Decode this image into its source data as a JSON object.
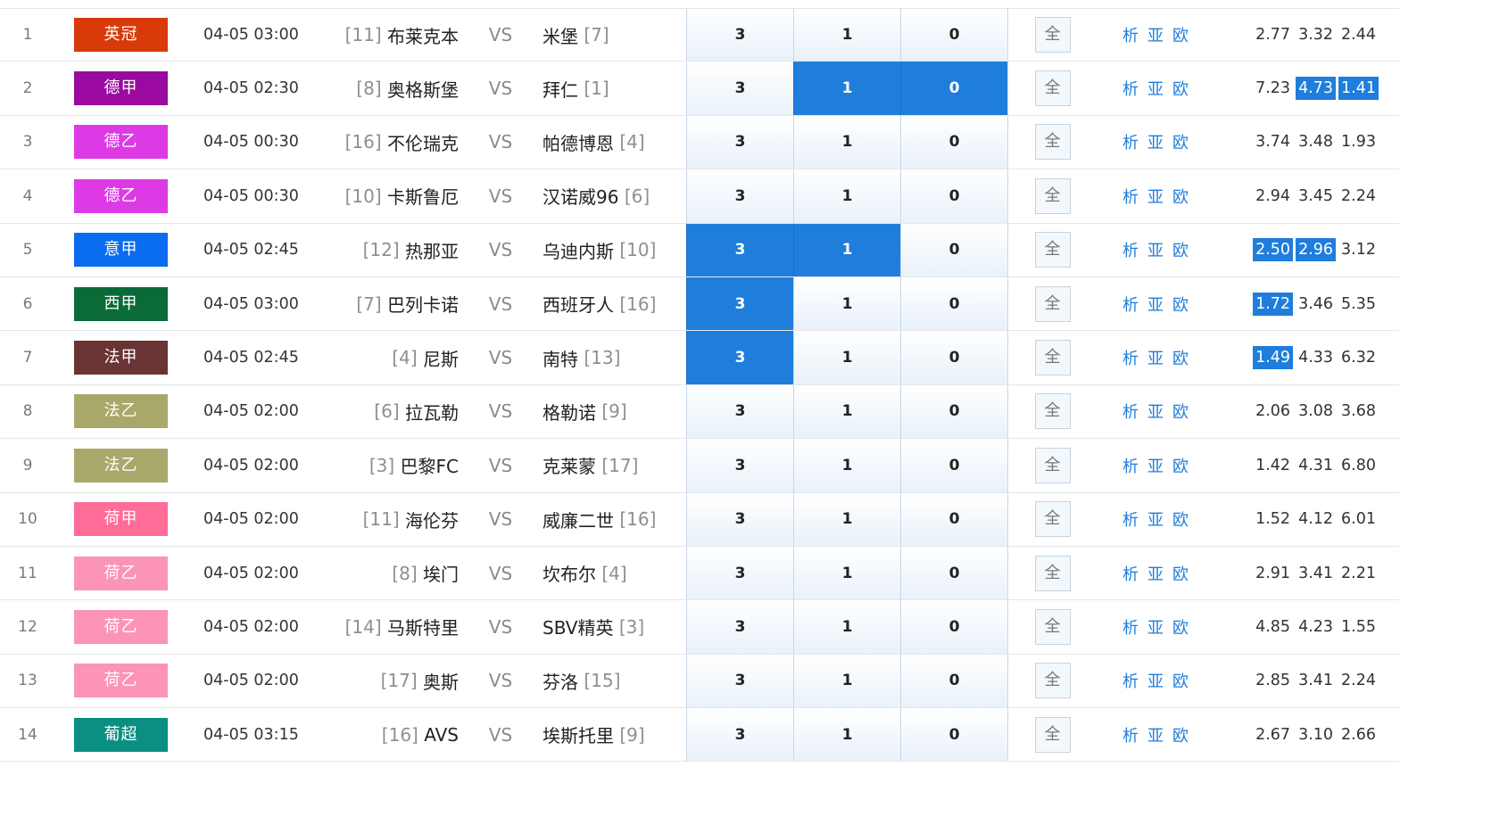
{
  "colors": {
    "selected_blue": "#1f7ddb",
    "league_colors": {
      "英冠": "#d83a0a",
      "德甲": "#9a0aa0",
      "德乙": "#dd3ae6",
      "意甲": "#0a6cf0",
      "西甲": "#0a6b38",
      "法甲": "#6b3434",
      "法乙": "#a9a86b",
      "荷甲": "#ff6c98",
      "荷乙": "#fb94b5",
      "葡超": "#0a8f82"
    }
  },
  "icons": {
    "quan": "全-box"
  },
  "columns": {
    "vs": "VS",
    "sel_3": "3",
    "sel_1": "1",
    "sel_0": "0",
    "quan": "全",
    "link_xi": "析",
    "link_ya": "亚",
    "link_ou": "欧"
  },
  "matches": [
    {
      "num": "1",
      "league": "英冠",
      "time": "04-05 03:00",
      "home_rank": "[11]",
      "home": "布莱克本",
      "away": "米堡",
      "away_rank": "[7]",
      "sel": [
        false,
        false,
        false
      ],
      "odds": [
        "2.77",
        "3.32",
        "2.44"
      ],
      "hl": [
        false,
        false,
        false
      ]
    },
    {
      "num": "2",
      "league": "德甲",
      "time": "04-05 02:30",
      "home_rank": "[8]",
      "home": "奥格斯堡",
      "away": "拜仁",
      "away_rank": "[1]",
      "sel": [
        false,
        true,
        true
      ],
      "odds": [
        "7.23",
        "4.73",
        "1.41"
      ],
      "hl": [
        false,
        true,
        true
      ]
    },
    {
      "num": "3",
      "league": "德乙",
      "time": "04-05 00:30",
      "home_rank": "[16]",
      "home": "不伦瑞克",
      "away": "帕德博恩",
      "away_rank": "[4]",
      "sel": [
        false,
        false,
        false
      ],
      "odds": [
        "3.74",
        "3.48",
        "1.93"
      ],
      "hl": [
        false,
        false,
        false
      ]
    },
    {
      "num": "4",
      "league": "德乙",
      "time": "04-05 00:30",
      "home_rank": "[10]",
      "home": "卡斯鲁厄",
      "away": "汉诺威96",
      "away_rank": "[6]",
      "sel": [
        false,
        false,
        false
      ],
      "odds": [
        "2.94",
        "3.45",
        "2.24"
      ],
      "hl": [
        false,
        false,
        false
      ]
    },
    {
      "num": "5",
      "league": "意甲",
      "time": "04-05 02:45",
      "home_rank": "[12]",
      "home": "热那亚",
      "away": "乌迪内斯",
      "away_rank": "[10]",
      "sel": [
        true,
        true,
        false
      ],
      "odds": [
        "2.50",
        "2.96",
        "3.12"
      ],
      "hl": [
        true,
        true,
        false
      ]
    },
    {
      "num": "6",
      "league": "西甲",
      "time": "04-05 03:00",
      "home_rank": "[7]",
      "home": "巴列卡诺",
      "away": "西班牙人",
      "away_rank": "[16]",
      "sel": [
        true,
        false,
        false
      ],
      "odds": [
        "1.72",
        "3.46",
        "5.35"
      ],
      "hl": [
        true,
        false,
        false
      ]
    },
    {
      "num": "7",
      "league": "法甲",
      "time": "04-05 02:45",
      "home_rank": "[4]",
      "home": "尼斯",
      "away": "南特",
      "away_rank": "[13]",
      "sel": [
        true,
        false,
        false
      ],
      "odds": [
        "1.49",
        "4.33",
        "6.32"
      ],
      "hl": [
        true,
        false,
        false
      ]
    },
    {
      "num": "8",
      "league": "法乙",
      "time": "04-05 02:00",
      "home_rank": "[6]",
      "home": "拉瓦勒",
      "away": "格勒诺",
      "away_rank": "[9]",
      "sel": [
        false,
        false,
        false
      ],
      "odds": [
        "2.06",
        "3.08",
        "3.68"
      ],
      "hl": [
        false,
        false,
        false
      ]
    },
    {
      "num": "9",
      "league": "法乙",
      "time": "04-05 02:00",
      "home_rank": "[3]",
      "home": "巴黎FC",
      "away": "克莱蒙",
      "away_rank": "[17]",
      "sel": [
        false,
        false,
        false
      ],
      "odds": [
        "1.42",
        "4.31",
        "6.80"
      ],
      "hl": [
        false,
        false,
        false
      ]
    },
    {
      "num": "10",
      "league": "荷甲",
      "time": "04-05 02:00",
      "home_rank": "[11]",
      "home": "海伦芬",
      "away": "威廉二世",
      "away_rank": "[16]",
      "sel": [
        false,
        false,
        false
      ],
      "odds": [
        "1.52",
        "4.12",
        "6.01"
      ],
      "hl": [
        false,
        false,
        false
      ]
    },
    {
      "num": "11",
      "league": "荷乙",
      "time": "04-05 02:00",
      "home_rank": "[8]",
      "home": "埃门",
      "away": "坎布尔",
      "away_rank": "[4]",
      "sel": [
        false,
        false,
        false
      ],
      "odds": [
        "2.91",
        "3.41",
        "2.21"
      ],
      "hl": [
        false,
        false,
        false
      ]
    },
    {
      "num": "12",
      "league": "荷乙",
      "time": "04-05 02:00",
      "home_rank": "[14]",
      "home": "马斯特里",
      "away": "SBV精英",
      "away_rank": "[3]",
      "sel": [
        false,
        false,
        false
      ],
      "odds": [
        "4.85",
        "4.23",
        "1.55"
      ],
      "hl": [
        false,
        false,
        false
      ]
    },
    {
      "num": "13",
      "league": "荷乙",
      "time": "04-05 02:00",
      "home_rank": "[17]",
      "home": "奥斯",
      "away": "芬洛",
      "away_rank": "[15]",
      "sel": [
        false,
        false,
        false
      ],
      "odds": [
        "2.85",
        "3.41",
        "2.24"
      ],
      "hl": [
        false,
        false,
        false
      ]
    },
    {
      "num": "14",
      "league": "葡超",
      "time": "04-05 03:15",
      "home_rank": "[16]",
      "home": "AVS",
      "away": "埃斯托里",
      "away_rank": "[9]",
      "sel": [
        false,
        false,
        false
      ],
      "odds": [
        "2.67",
        "3.10",
        "2.66"
      ],
      "hl": [
        false,
        false,
        false
      ]
    }
  ]
}
